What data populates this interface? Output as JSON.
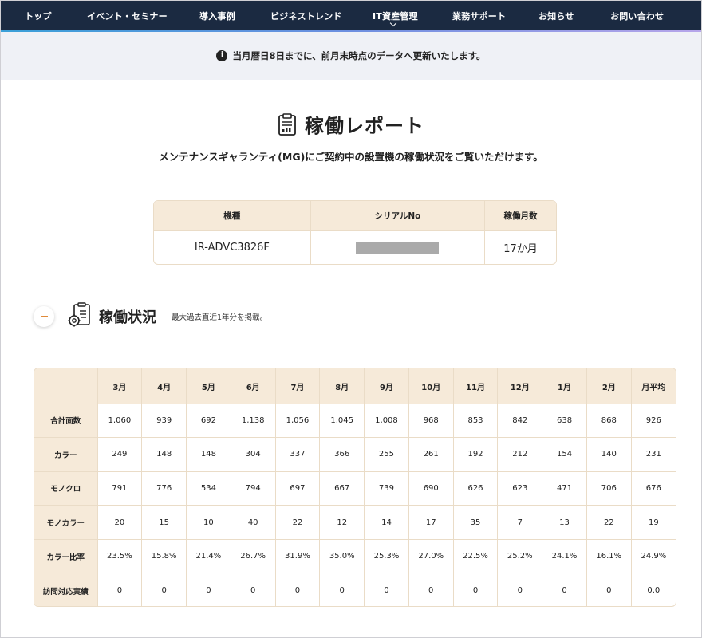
{
  "nav": {
    "items": [
      "トップ",
      "イベント・セミナー",
      "導入事例",
      "ビジネストレンド",
      "IT資産管理",
      "業務サポート",
      "お知らせ",
      "お問い合わせ"
    ]
  },
  "notice": {
    "text": "当月暦日8日までに、前月末時点のデータへ更新いたします。"
  },
  "page": {
    "title": "稼働レポート",
    "subtitle": "メンテナンスギャランティ(MG)にご契約中の設置機の稼働状況をご覧いただけます。"
  },
  "machine": {
    "headers": [
      "機種",
      "シリアルNo",
      "稼働月数"
    ],
    "model": "IR-ADVC3826F",
    "months": "17か月"
  },
  "section": {
    "title": "稼働状況",
    "note": "最大過去直近1年分を掲載。"
  },
  "table": {
    "columns": [
      "3月",
      "4月",
      "5月",
      "6月",
      "7月",
      "8月",
      "9月",
      "10月",
      "11月",
      "12月",
      "1月",
      "2月",
      "月平均"
    ],
    "rows": [
      {
        "label": "合計面数",
        "values": [
          "1,060",
          "939",
          "692",
          "1,138",
          "1,056",
          "1,045",
          "1,008",
          "968",
          "853",
          "842",
          "638",
          "868",
          "926"
        ]
      },
      {
        "label": "カラー",
        "values": [
          "249",
          "148",
          "148",
          "304",
          "337",
          "366",
          "255",
          "261",
          "192",
          "212",
          "154",
          "140",
          "231"
        ]
      },
      {
        "label": "モノクロ",
        "values": [
          "791",
          "776",
          "534",
          "794",
          "697",
          "667",
          "739",
          "690",
          "626",
          "623",
          "471",
          "706",
          "676"
        ]
      },
      {
        "label": "モノカラー",
        "values": [
          "20",
          "15",
          "10",
          "40",
          "22",
          "12",
          "14",
          "17",
          "35",
          "7",
          "13",
          "22",
          "19"
        ]
      },
      {
        "label": "カラー比率",
        "values": [
          "23.5%",
          "15.8%",
          "21.4%",
          "26.7%",
          "31.9%",
          "35.0%",
          "25.3%",
          "27.0%",
          "22.5%",
          "25.2%",
          "24.1%",
          "16.1%",
          "24.9%"
        ]
      },
      {
        "label": "訪問対応実績",
        "values": [
          "0",
          "0",
          "0",
          "0",
          "0",
          "0",
          "0",
          "0",
          "0",
          "0",
          "0",
          "0",
          "0.0"
        ]
      }
    ]
  }
}
